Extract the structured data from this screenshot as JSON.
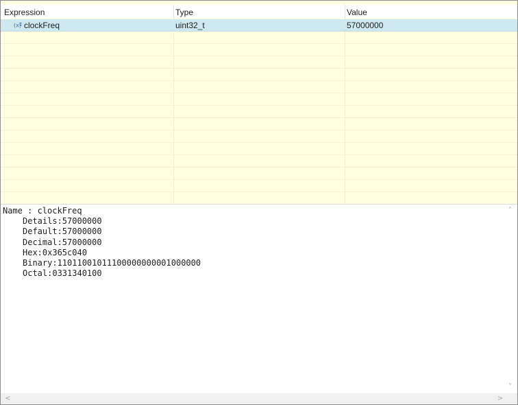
{
  "columns": {
    "expression": "Expression",
    "type": "Type",
    "value": "Value"
  },
  "rows": [
    {
      "icon": "variable-icon",
      "expression": "clockFreq",
      "type": "uint32_t",
      "value": "57000000"
    }
  ],
  "details": {
    "name_line": "Name : clockFreq",
    "lines": [
      "Details:57000000",
      "Default:57000000",
      "Decimal:57000000",
      "Hex:0x365c040",
      "Binary:11011001011100000000001000000",
      "Octal:0331340100"
    ]
  },
  "scroll_arrows": {
    "up": "˄",
    "down": "˅",
    "left": "<",
    "right": ">"
  },
  "colors": {
    "table_background": "#fffee0",
    "selected_row": "#cde8ee"
  }
}
